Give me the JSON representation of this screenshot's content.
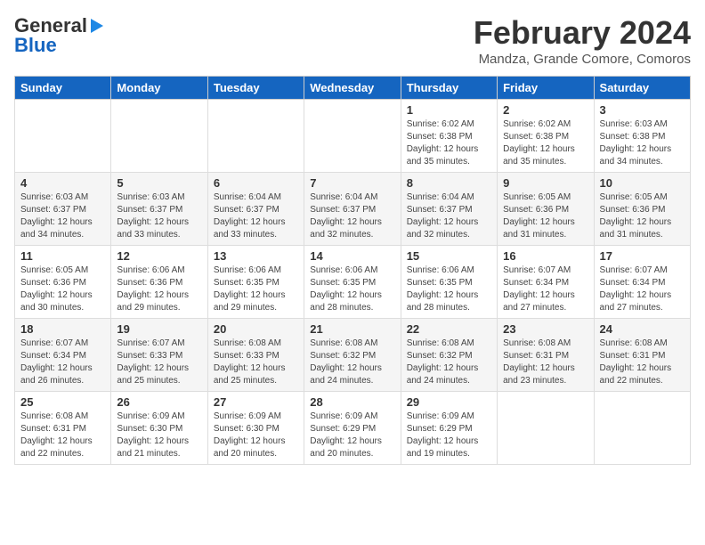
{
  "logo": {
    "line1": "General",
    "line2": "Blue"
  },
  "title": {
    "month_year": "February 2024",
    "location": "Mandza, Grande Comore, Comoros"
  },
  "weekdays": [
    "Sunday",
    "Monday",
    "Tuesday",
    "Wednesday",
    "Thursday",
    "Friday",
    "Saturday"
  ],
  "weeks": [
    [
      {
        "day": "",
        "info": ""
      },
      {
        "day": "",
        "info": ""
      },
      {
        "day": "",
        "info": ""
      },
      {
        "day": "",
        "info": ""
      },
      {
        "day": "1",
        "info": "Sunrise: 6:02 AM\nSunset: 6:38 PM\nDaylight: 12 hours\nand 35 minutes."
      },
      {
        "day": "2",
        "info": "Sunrise: 6:02 AM\nSunset: 6:38 PM\nDaylight: 12 hours\nand 35 minutes."
      },
      {
        "day": "3",
        "info": "Sunrise: 6:03 AM\nSunset: 6:38 PM\nDaylight: 12 hours\nand 34 minutes."
      }
    ],
    [
      {
        "day": "4",
        "info": "Sunrise: 6:03 AM\nSunset: 6:37 PM\nDaylight: 12 hours\nand 34 minutes."
      },
      {
        "day": "5",
        "info": "Sunrise: 6:03 AM\nSunset: 6:37 PM\nDaylight: 12 hours\nand 33 minutes."
      },
      {
        "day": "6",
        "info": "Sunrise: 6:04 AM\nSunset: 6:37 PM\nDaylight: 12 hours\nand 33 minutes."
      },
      {
        "day": "7",
        "info": "Sunrise: 6:04 AM\nSunset: 6:37 PM\nDaylight: 12 hours\nand 32 minutes."
      },
      {
        "day": "8",
        "info": "Sunrise: 6:04 AM\nSunset: 6:37 PM\nDaylight: 12 hours\nand 32 minutes."
      },
      {
        "day": "9",
        "info": "Sunrise: 6:05 AM\nSunset: 6:36 PM\nDaylight: 12 hours\nand 31 minutes."
      },
      {
        "day": "10",
        "info": "Sunrise: 6:05 AM\nSunset: 6:36 PM\nDaylight: 12 hours\nand 31 minutes."
      }
    ],
    [
      {
        "day": "11",
        "info": "Sunrise: 6:05 AM\nSunset: 6:36 PM\nDaylight: 12 hours\nand 30 minutes."
      },
      {
        "day": "12",
        "info": "Sunrise: 6:06 AM\nSunset: 6:36 PM\nDaylight: 12 hours\nand 29 minutes."
      },
      {
        "day": "13",
        "info": "Sunrise: 6:06 AM\nSunset: 6:35 PM\nDaylight: 12 hours\nand 29 minutes."
      },
      {
        "day": "14",
        "info": "Sunrise: 6:06 AM\nSunset: 6:35 PM\nDaylight: 12 hours\nand 28 minutes."
      },
      {
        "day": "15",
        "info": "Sunrise: 6:06 AM\nSunset: 6:35 PM\nDaylight: 12 hours\nand 28 minutes."
      },
      {
        "day": "16",
        "info": "Sunrise: 6:07 AM\nSunset: 6:34 PM\nDaylight: 12 hours\nand 27 minutes."
      },
      {
        "day": "17",
        "info": "Sunrise: 6:07 AM\nSunset: 6:34 PM\nDaylight: 12 hours\nand 27 minutes."
      }
    ],
    [
      {
        "day": "18",
        "info": "Sunrise: 6:07 AM\nSunset: 6:34 PM\nDaylight: 12 hours\nand 26 minutes."
      },
      {
        "day": "19",
        "info": "Sunrise: 6:07 AM\nSunset: 6:33 PM\nDaylight: 12 hours\nand 25 minutes."
      },
      {
        "day": "20",
        "info": "Sunrise: 6:08 AM\nSunset: 6:33 PM\nDaylight: 12 hours\nand 25 minutes."
      },
      {
        "day": "21",
        "info": "Sunrise: 6:08 AM\nSunset: 6:32 PM\nDaylight: 12 hours\nand 24 minutes."
      },
      {
        "day": "22",
        "info": "Sunrise: 6:08 AM\nSunset: 6:32 PM\nDaylight: 12 hours\nand 24 minutes."
      },
      {
        "day": "23",
        "info": "Sunrise: 6:08 AM\nSunset: 6:31 PM\nDaylight: 12 hours\nand 23 minutes."
      },
      {
        "day": "24",
        "info": "Sunrise: 6:08 AM\nSunset: 6:31 PM\nDaylight: 12 hours\nand 22 minutes."
      }
    ],
    [
      {
        "day": "25",
        "info": "Sunrise: 6:08 AM\nSunset: 6:31 PM\nDaylight: 12 hours\nand 22 minutes."
      },
      {
        "day": "26",
        "info": "Sunrise: 6:09 AM\nSunset: 6:30 PM\nDaylight: 12 hours\nand 21 minutes."
      },
      {
        "day": "27",
        "info": "Sunrise: 6:09 AM\nSunset: 6:30 PM\nDaylight: 12 hours\nand 20 minutes."
      },
      {
        "day": "28",
        "info": "Sunrise: 6:09 AM\nSunset: 6:29 PM\nDaylight: 12 hours\nand 20 minutes."
      },
      {
        "day": "29",
        "info": "Sunrise: 6:09 AM\nSunset: 6:29 PM\nDaylight: 12 hours\nand 19 minutes."
      },
      {
        "day": "",
        "info": ""
      },
      {
        "day": "",
        "info": ""
      }
    ]
  ]
}
